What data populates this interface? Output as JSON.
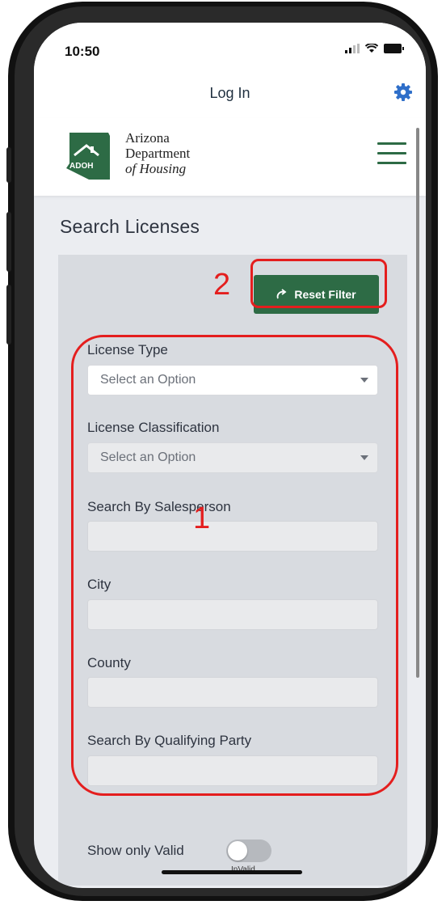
{
  "status_bar": {
    "time": "10:50"
  },
  "header": {
    "login_label": "Log In"
  },
  "brand": {
    "badge": "ADOH",
    "line1": "Arizona",
    "line2": "Department",
    "line3": "of Housing"
  },
  "page": {
    "title": "Search Licenses"
  },
  "filters": {
    "reset_label": "Reset Filter",
    "license_type": {
      "label": "License Type",
      "value": "Select an Option"
    },
    "license_classification": {
      "label": "License Classification",
      "value": "Select an Option"
    },
    "salesperson": {
      "label": "Search By Salesperson",
      "value": ""
    },
    "city": {
      "label": "City",
      "value": ""
    },
    "county": {
      "label": "County",
      "value": ""
    },
    "qualifying_party": {
      "label": "Search By Qualifying Party",
      "value": ""
    },
    "show_valid": {
      "label": "Show only Valid",
      "state": "InValid"
    }
  },
  "annotations": {
    "one": "1",
    "two": "2"
  },
  "colors": {
    "brand_green": "#2d6b45",
    "annotation_red": "#e41e1e"
  }
}
